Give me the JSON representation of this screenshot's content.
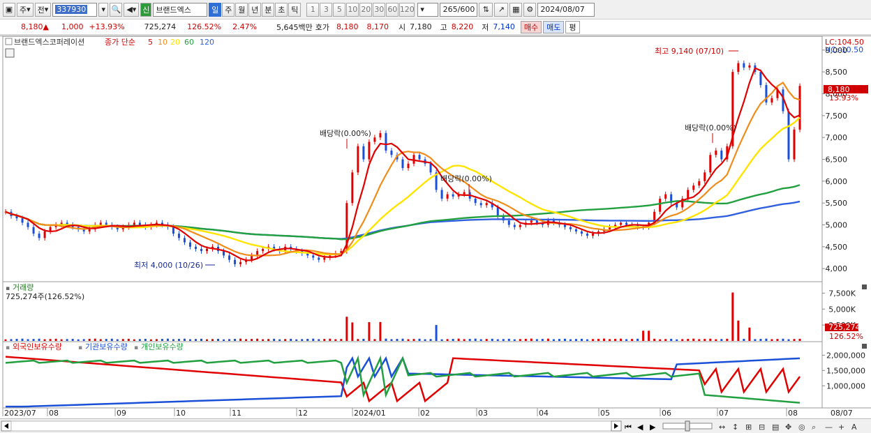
{
  "toolbar": {
    "market": "주",
    "prev": "전",
    "code": "337930",
    "new_badge": "신",
    "name": "브랜드엑스",
    "periods": [
      "일",
      "주",
      "월",
      "년",
      "분",
      "초",
      "틱"
    ],
    "active_period": "일",
    "intervals": [
      "1",
      "3",
      "5",
      "10",
      "20",
      "30",
      "60",
      "120"
    ],
    "count": "265",
    "count_max": "/600",
    "date": "2024/08/07"
  },
  "quote": {
    "price": "8,180",
    "change": "1,000",
    "change_pct": "+13.93%",
    "volume": "725,274",
    "vol_ratio": "126.52%",
    "turnover": "2.47%",
    "amount": "5,645백만",
    "hoga_label": "호가",
    "ask": "8,180",
    "bid": "8,170",
    "open_label": "시",
    "open": "7,180",
    "high_label": "고",
    "high": "8,220",
    "low_label": "저",
    "low": "7,140",
    "buy": "매수",
    "sell": "매도",
    "avg": "평"
  },
  "price_panel": {
    "name": "브랜드엑스코퍼레이션",
    "ma_title": "종가 단순",
    "ma_periods": [
      "5",
      "10",
      "20",
      "60",
      "120"
    ],
    "lc": "LC:104.50",
    "hc": "HC:-10.50",
    "max_label": "최고 9,140 (07/10)",
    "min_label": "최저 4,000 (10/26)",
    "div_labels": [
      "배당락(0.00%)",
      "배당락(0.00%)",
      "배당락(0.00%)"
    ],
    "cur_price": "8,180",
    "cur_pct": "13.93%"
  },
  "volume_panel": {
    "title": "거래량",
    "value": "725,274주(126.52%)",
    "cur": "725,274",
    "cur_pct": "126.52%"
  },
  "holdings_panel": {
    "legend": [
      "외국인보유수량",
      "기관보유수량",
      "개인보유수량"
    ]
  },
  "colors": {
    "up": "#e00000",
    "down": "#1a4fd8",
    "ma5": "#e00000",
    "ma10": "#f08c1a",
    "ma20": "#ffe400",
    "ma60": "#22a040",
    "ma120": "#3060e0"
  },
  "chart_data": {
    "type": "candlestick",
    "price_axis": [
      "9,000",
      "8,500",
      "8,000",
      "7,500",
      "7,000",
      "6,500",
      "6,000",
      "5,500",
      "5,000",
      "4,500",
      "4,000"
    ],
    "volume_axis": [
      "7,500K",
      "5,000K",
      "2,500K"
    ],
    "holdings_axis": [
      "2,000,000",
      "1,500,000",
      "1,000,000"
    ],
    "x_labels": [
      "2023/07",
      "08",
      "09",
      "10",
      "11",
      "12",
      "2024/01",
      "02",
      "03",
      "04",
      "05",
      "06",
      "07",
      "08",
      "08/07"
    ],
    "close": [
      5300,
      5200,
      5150,
      5050,
      4950,
      4800,
      4700,
      4850,
      4950,
      5000,
      5050,
      5000,
      4950,
      4900,
      4850,
      4900,
      5000,
      5050,
      5000,
      4950,
      4900,
      4950,
      5000,
      5050,
      5000,
      4950,
      5000,
      5050,
      5000,
      4950,
      4800,
      4700,
      4600,
      4500,
      4450,
      4400,
      4450,
      4500,
      4400,
      4300,
      4200,
      4100,
      4150,
      4200,
      4300,
      4400,
      4450,
      4500,
      4450,
      4400,
      4500,
      4450,
      4400,
      4350,
      4300,
      4250,
      4200,
      4250,
      4300,
      4350,
      4400,
      5500,
      6200,
      6800,
      6500,
      6900,
      7000,
      7100,
      6700,
      6600,
      6500,
      6300,
      6400,
      6600,
      6500,
      6400,
      6200,
      5800,
      5600,
      5700,
      5650,
      5700,
      5750,
      5600,
      5500,
      5450,
      5500,
      5400,
      5200,
      5100,
      5000,
      4950,
      5000,
      5050,
      5100,
      5050,
      5000,
      5100,
      5050,
      5000,
      4950,
      4900,
      4850,
      4800,
      4750,
      4800,
      4850,
      4900,
      4950,
      5000,
      5050,
      5000,
      5000,
      4950,
      4950,
      5050,
      5300,
      5600,
      5700,
      5500,
      5400,
      5600,
      5800,
      5900,
      6000,
      6200,
      6600,
      6700,
      6500,
      6800,
      8500,
      8700,
      8600,
      8650,
      8500,
      8200,
      7800,
      7900,
      8100,
      7600,
      6500,
      7180,
      8180
    ],
    "series": [
      {
        "name": "5"
      },
      {
        "name": "10"
      },
      {
        "name": "20"
      },
      {
        "name": "60"
      },
      {
        "name": "120"
      }
    ]
  }
}
